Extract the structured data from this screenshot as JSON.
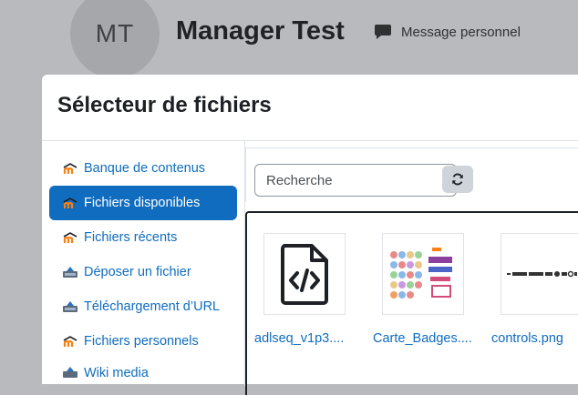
{
  "user": {
    "initials": "MT",
    "name": "Manager Test",
    "message_label": "Message personnel"
  },
  "modal": {
    "title": "Sélecteur de fichiers"
  },
  "sidebar": {
    "items": [
      {
        "label": "Banque de contenus",
        "icon": "moodle-icon",
        "active": false
      },
      {
        "label": "Fichiers disponibles",
        "icon": "moodle-icon",
        "active": true
      },
      {
        "label": "Fichiers récents",
        "icon": "moodle-icon",
        "active": false
      },
      {
        "label": "Déposer un fichier",
        "icon": "upload-icon",
        "active": false
      },
      {
        "label": "Téléchargement d’URL",
        "icon": "upload-icon",
        "active": false
      },
      {
        "label": "Fichiers personnels",
        "icon": "moodle-icon",
        "active": false
      },
      {
        "label": "Wiki media",
        "icon": "upload-icon",
        "active": false
      }
    ]
  },
  "search": {
    "placeholder": "Recherche",
    "refresh_icon": "refresh-icon"
  },
  "files": [
    {
      "name": "adlseq_v1p3....",
      "icon": "code-file-icon"
    },
    {
      "name": "Carte_Badges....",
      "icon": "image-thumbnail"
    },
    {
      "name": "controls.png",
      "icon": "image-thumbnail"
    }
  ],
  "colors": {
    "link": "#0f6cbf",
    "active_bg": "#0f6cbf",
    "overlay": "#b8babd"
  }
}
